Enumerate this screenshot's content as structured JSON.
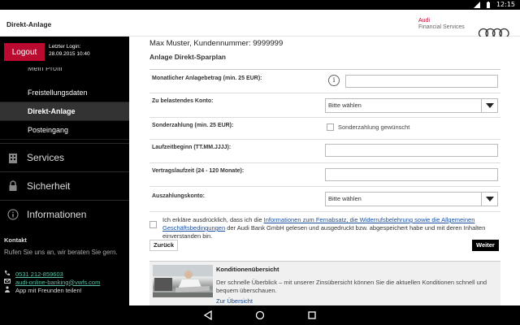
{
  "status_bar": {
    "time": "12:15"
  },
  "header": {
    "title": "Direkt-Anlage",
    "brand_line1": "Audi",
    "brand_line2": "Financial Services"
  },
  "sidebar": {
    "logout_label": "Logout",
    "last_login_label": "Letzter Login:",
    "last_login_value": "28.09.2015 10:40",
    "cut_item": "Mein Profil",
    "sub_items": [
      {
        "label": "Freistellungsdaten"
      },
      {
        "label": "Direkt-Anlage"
      },
      {
        "label": "Posteingang"
      }
    ],
    "main_items": [
      {
        "label": "Services",
        "icon": "building-icon"
      },
      {
        "label": "Sicherheit",
        "icon": "lock-icon"
      },
      {
        "label": "Informationen",
        "icon": "info-icon"
      }
    ],
    "contact": {
      "heading": "Kontakt",
      "text": "Rufen Sie uns an, wir beraten Sie gern.",
      "phone": "0531 212-859603",
      "email": "audi-online-banking@vwfs.com",
      "share": "App mit Freunden teilen!"
    }
  },
  "main": {
    "customer_line": "Max Muster, Kundennummer: 9999999",
    "section_title": "Anlage Direkt-Sparplan",
    "form": {
      "monthly_amount_label": "Monatlicher Anlagebetrag (min. 25 EUR):",
      "monthly_amount_value": "",
      "debit_account_label": "Zu belastendes Konto:",
      "debit_account_value": "Bitte wählen",
      "special_payment_label": "Sonderzahlung (min. 25 EUR):",
      "special_payment_checkbox_label": "Sonderzahlung gewünscht",
      "start_label": "Laufzeitbeginn (TT.MM.JJJJ):",
      "start_value": "",
      "duration_label": "Vertragslaufzeit (24 - 120 Monate):",
      "duration_value": "",
      "payout_account_label": "Auszahlungskonto:",
      "payout_account_value": "Bitte wählen"
    },
    "consent": {
      "prefix": "Ich erkläre ausdrücklich, dass ich die ",
      "link": "Informationen zum Fernabsatz, die Widerrufsbelehrung sowie die Allgemeinen Geschäftsbedingungen",
      "suffix": " der Audi Bank GmbH gelesen und ausgedruckt bzw. abgespeichert habe und mit deren Inhalten einverstanden bin."
    },
    "back_label": "Zurück",
    "next_label": "Weiter",
    "promo": {
      "heading": "Konditionenübersicht",
      "text": "Der schnelle Überblick – mit unserer Zinsübersicht können Sie die aktuellen Konditionen schnell und bequem überschauen.",
      "link": "Zur Übersicht"
    }
  },
  "colors": {
    "brand_red": "#bb0a30",
    "sidebar_bg": "#000000",
    "active_item_bg": "#333333",
    "contact_link": "#5cc0a8",
    "link_blue": "#1a4fa0"
  }
}
